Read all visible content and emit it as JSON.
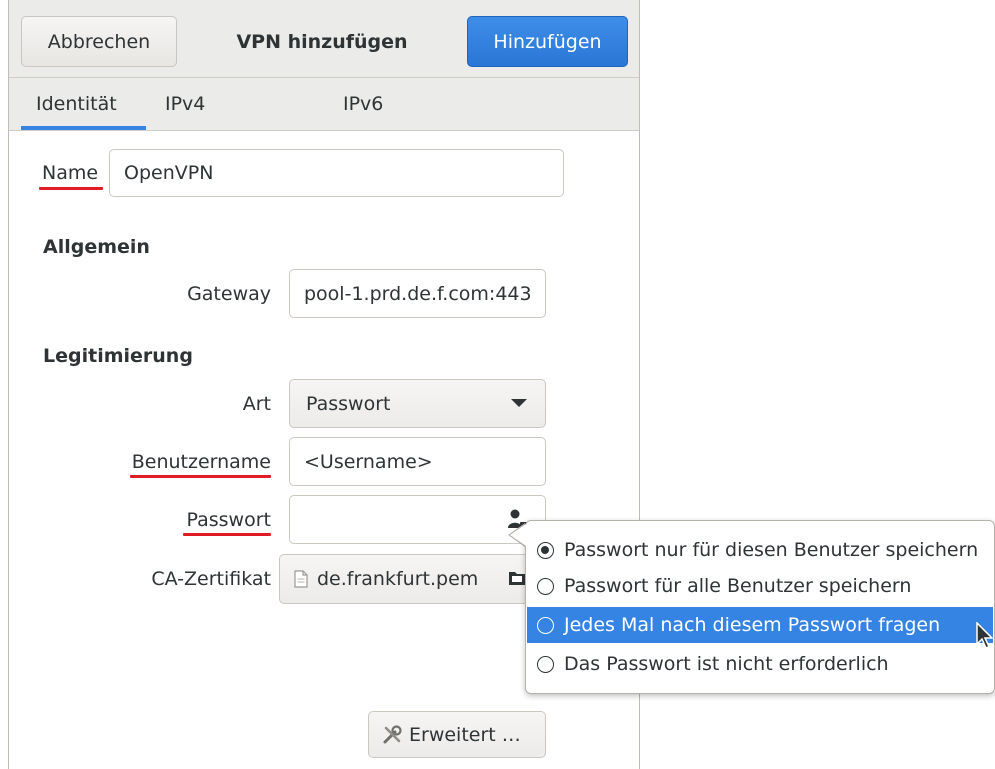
{
  "header": {
    "cancel_label": "Abbrechen",
    "title": "VPN hinzufügen",
    "add_label": "Hinzufügen"
  },
  "tabs": [
    {
      "label": "Identität",
      "active": true
    },
    {
      "label": "IPv4",
      "active": false
    },
    {
      "label": "IPv6",
      "active": false
    }
  ],
  "form": {
    "name_label": "Name",
    "name_value": "OpenVPN",
    "general_heading": "Allgemein",
    "gateway_label": "Gateway",
    "gateway_value": "pool-1.prd.de.f.com:443",
    "auth_heading": "Legitimierung",
    "type_label": "Art",
    "type_value": "Passwort",
    "username_label": "Benutzername",
    "username_value": "<Username>",
    "password_label": "Passwort",
    "password_value": "",
    "ca_label": "CA-Zertifikat",
    "ca_file": "de.frankfurt.pem",
    "advanced_label": "Erweitert …"
  },
  "password_menu": {
    "options": [
      {
        "label": "Passwort nur für diesen Benutzer speichern",
        "checked": true,
        "highlighted": false
      },
      {
        "label": "Passwort für alle Benutzer speichern",
        "checked": false,
        "highlighted": false
      },
      {
        "label": "Jedes Mal nach diesem Passwort fragen",
        "checked": false,
        "highlighted": true
      },
      {
        "label": "Das Passwort ist nicht erforderlich",
        "checked": false,
        "highlighted": false
      }
    ]
  },
  "colors": {
    "accent": "#3584e4",
    "annotation_underline": "#e01b24"
  }
}
